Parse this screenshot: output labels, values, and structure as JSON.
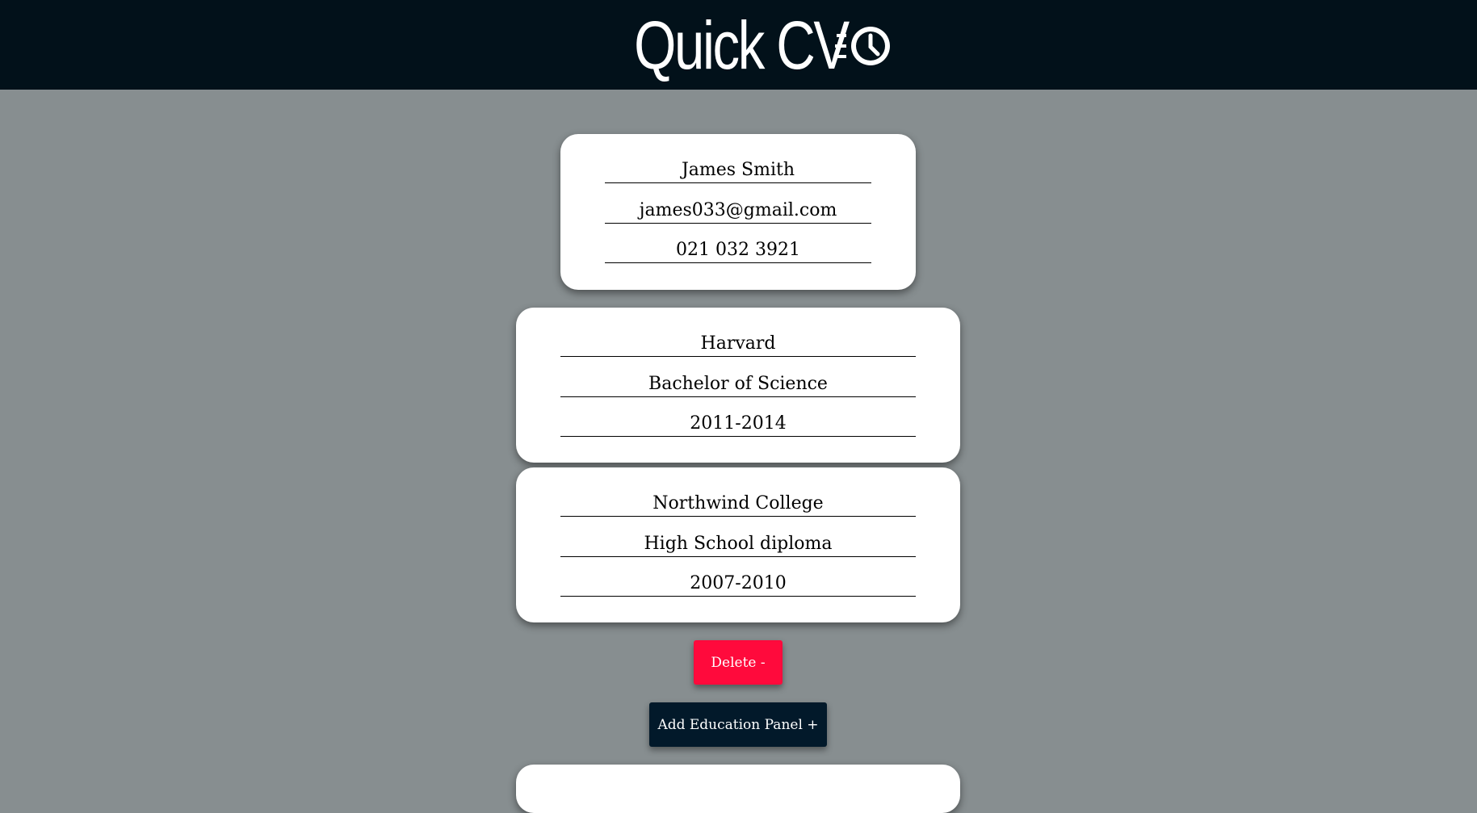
{
  "header": {
    "title": "Quick CV",
    "icon": "fast-clock-icon",
    "background": "#02111a"
  },
  "personal": {
    "name": "James Smith",
    "email": "james033@gmail.com",
    "phone": "021 032 3921"
  },
  "education": [
    {
      "school": "Harvard",
      "degree": "Bachelor of Science",
      "years": "2011-2014"
    },
    {
      "school": "Northwind College",
      "degree": "High School diploma",
      "years": "2007-2010"
    }
  ],
  "actions": {
    "delete_label": "Delete -",
    "add_label": "Add Education Panel +"
  },
  "colors": {
    "page_background": "#878e90",
    "delete": "#ff0a3c",
    "add": "#02192a"
  }
}
